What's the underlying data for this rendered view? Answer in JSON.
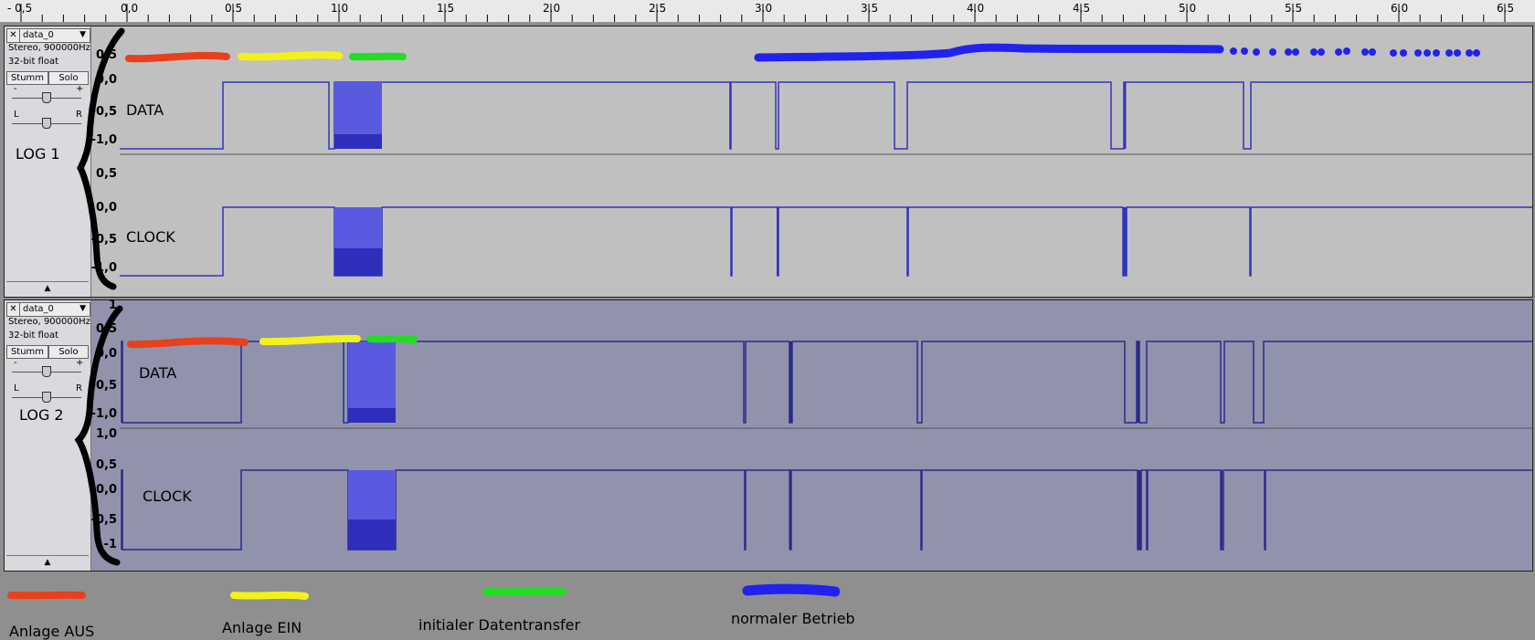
{
  "ruler": {
    "labels": [
      "- 0,5",
      "0,0",
      "0.5",
      "1.0",
      "1.5",
      "2.0",
      "2.5",
      "3.0",
      "3.5",
      "4.0",
      "4.5",
      "5.0",
      "5.5",
      "6.0",
      "6.5"
    ]
  },
  "tracks": [
    {
      "name": "data_0",
      "info1": "Stereo, 900000Hz",
      "info2": "32-bit float",
      "mute": "Stumm",
      "solo": "Solo",
      "gain_minus": "-",
      "gain_plus": "+",
      "pan_left": "L",
      "pan_right": "R",
      "log_label": "LOG 1",
      "scale_ch1": [
        "0,5",
        "0,0",
        "-0,5",
        "-1,0"
      ],
      "scale_ch2": [
        "0,5",
        "0,0",
        "-0,5",
        "-1,0"
      ],
      "ch1_label": "DATA",
      "ch2_label": "CLOCK"
    },
    {
      "name": "data_0",
      "info1": "Stereo, 900000Hz",
      "info2": "32-bit float",
      "mute": "Stumm",
      "solo": "Solo",
      "gain_minus": "-",
      "gain_plus": "+",
      "pan_left": "L",
      "pan_right": "R",
      "log_label": "LOG 2",
      "scale_ch1": [
        "1",
        "0,5",
        "0,0",
        "-0,5",
        "-1,0"
      ],
      "scale_ch2": [
        "1,0",
        "0,5",
        "0,0",
        "-0,5",
        "-1"
      ],
      "ch1_label": "DATA",
      "ch2_label": "CLOCK"
    }
  ],
  "legend": {
    "off": "Anlage AUS",
    "on": "Anlage EIN",
    "init": "initialer Datentransfer",
    "normal": "normaler Betrieb"
  },
  "colors": {
    "off": "#e8401c",
    "on": "#f2f21a",
    "init": "#22dd22",
    "normal": "#2222ee",
    "wave": "#3333bb",
    "burst": "#5a5ae0"
  }
}
